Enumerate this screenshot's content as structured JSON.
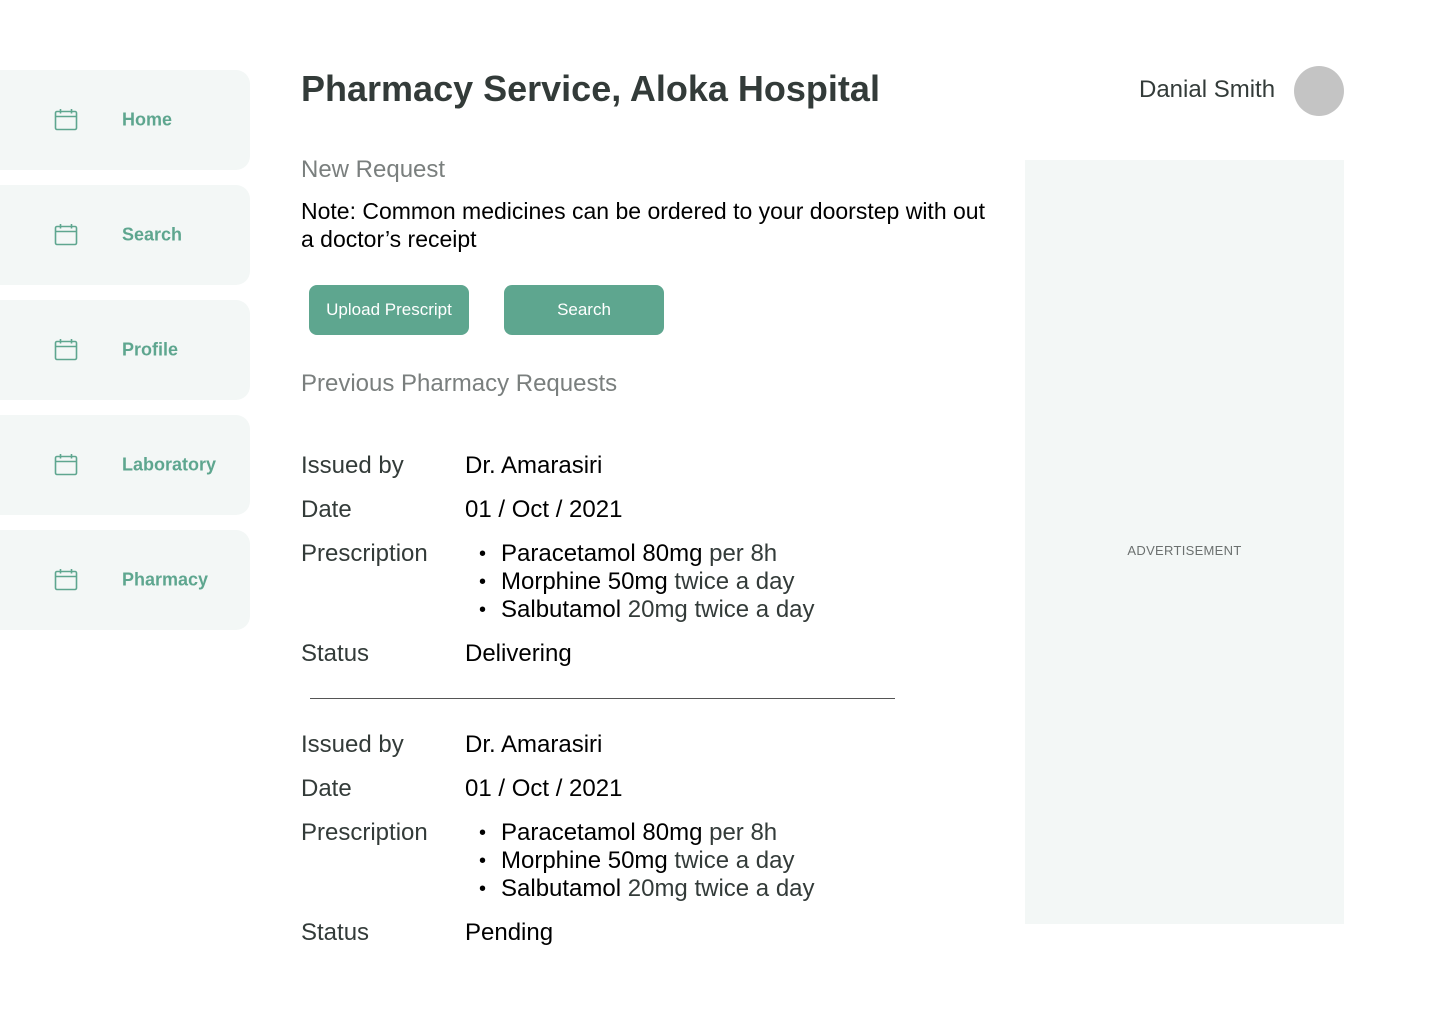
{
  "sidebar": {
    "items": [
      {
        "label": "Home",
        "icon": "calendar-icon"
      },
      {
        "label": "Search",
        "icon": "calendar-icon"
      },
      {
        "label": "Profile",
        "icon": "calendar-icon"
      },
      {
        "label": "Laboratory",
        "icon": "calendar-icon"
      },
      {
        "label": "Pharmacy",
        "icon": "calendar-icon"
      }
    ]
  },
  "header": {
    "title_prefix": "Pharmacy Service, ",
    "title_bold": "Aloka Hospital",
    "user_name": "Danial Smith"
  },
  "new_request": {
    "heading": "New Request",
    "note": "Note: Common medicines can be ordered to your doorstep with out a doctor’s receipt",
    "upload_button": "Upload Prescript",
    "search_button": "Search"
  },
  "previous": {
    "heading": "Previous Pharmacy Requests",
    "labels": {
      "issued_by": "Issued by",
      "date": "Date",
      "prescription": "Prescription",
      "status": "Status"
    },
    "requests": [
      {
        "issued_by": "Dr. Amarasiri",
        "date": "01 / Oct / 2021",
        "prescription": [
          {
            "medicine": "Paracetamol 80mg",
            "dose": " per 8h"
          },
          {
            "medicine": "Morphine 50mg",
            "dose": " twice a day"
          },
          {
            "medicine": "Salbutamol",
            "dose": " 20mg twice a day"
          }
        ],
        "status": "Delivering"
      },
      {
        "issued_by": "Dr. Amarasiri",
        "date": "01 / Oct / 2021",
        "prescription": [
          {
            "medicine": "Paracetamol 80mg",
            "dose": " per 8h"
          },
          {
            "medicine": "Morphine 50mg",
            "dose": " twice a day"
          },
          {
            "medicine": "Salbutamol",
            "dose": " 20mg twice a day"
          }
        ],
        "status": "Pending"
      }
    ]
  },
  "advertisement": {
    "label": "ADVERTISEMENT"
  },
  "colors": {
    "accent": "#5ea68f",
    "panel": "#f3f7f6",
    "avatar": "#c4c4c4"
  },
  "bullet": "•"
}
